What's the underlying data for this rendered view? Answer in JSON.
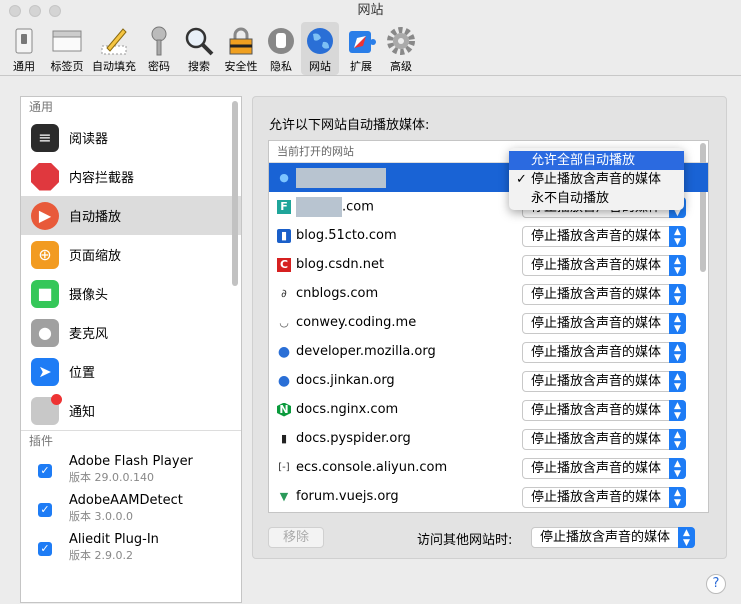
{
  "window": {
    "title": "网站"
  },
  "toolbar": [
    {
      "label": "通用",
      "icon": "general-switch-icon"
    },
    {
      "label": "标签页",
      "icon": "tabs-icon"
    },
    {
      "label": "自动填充",
      "icon": "autofill-pencil-icon"
    },
    {
      "label": "密码",
      "icon": "key-icon"
    },
    {
      "label": "搜索",
      "icon": "magnifier-icon"
    },
    {
      "label": "安全性",
      "icon": "lock-icon"
    },
    {
      "label": "隐私",
      "icon": "hand-icon"
    },
    {
      "label": "网站",
      "icon": "globe-icon"
    },
    {
      "label": "扩展",
      "icon": "puzzle-icon"
    },
    {
      "label": "高级",
      "icon": "gear-icon"
    }
  ],
  "sidebar": {
    "general_header": "通用",
    "items": [
      {
        "label": "阅读器",
        "icon": "reader-icon",
        "color": "#2b2b2b"
      },
      {
        "label": "内容拦截器",
        "icon": "stop-sign-icon",
        "color": "#e0383e"
      },
      {
        "label": "自动播放",
        "icon": "play-icon",
        "color": "#e85a3a"
      },
      {
        "label": "页面缩放",
        "icon": "zoom-icon",
        "color": "#f29b21"
      },
      {
        "label": "摄像头",
        "icon": "camera-icon",
        "color": "#35c759"
      },
      {
        "label": "麦克风",
        "icon": "microphone-icon",
        "color": "#a0a0a0"
      },
      {
        "label": "位置",
        "icon": "location-arrow-icon",
        "color": "#1e7cf5"
      },
      {
        "label": "通知",
        "icon": "notification-icon",
        "color": "#c8c8c8"
      }
    ],
    "plugins_header": "插件",
    "plugins": [
      {
        "name": "Adobe Flash Player",
        "version": "版本 29.0.0.140"
      },
      {
        "name": "AdobeAAMDetect",
        "version": "版本 3.0.0.0"
      },
      {
        "name": "Aliedit Plug-In",
        "version": "版本 2.9.0.2"
      }
    ]
  },
  "main": {
    "title": "允许以下网站自动播放媒体:",
    "table_header": "当前打开的网站",
    "rows": [
      {
        "site": "",
        "setting": "停止播放含声音的媒体"
      },
      {
        "site": ".com",
        "setting": "停止播放含声音的媒体"
      },
      {
        "site": "blog.51cto.com",
        "setting": "停止播放含声音的媒体"
      },
      {
        "site": "blog.csdn.net",
        "setting": "停止播放含声音的媒体"
      },
      {
        "site": "cnblogs.com",
        "setting": "停止播放含声音的媒体"
      },
      {
        "site": "conwey.coding.me",
        "setting": "停止播放含声音的媒体"
      },
      {
        "site": "developer.mozilla.org",
        "setting": "停止播放含声音的媒体"
      },
      {
        "site": "docs.jinkan.org",
        "setting": "停止播放含声音的媒体"
      },
      {
        "site": "docs.nginx.com",
        "setting": "停止播放含声音的媒体"
      },
      {
        "site": "docs.pyspider.org",
        "setting": "停止播放含声音的媒体"
      },
      {
        "site": "ecs.console.aliyun.com",
        "setting": "停止播放含声音的媒体"
      },
      {
        "site": "forum.vuejs.org",
        "setting": "停止播放含声音的媒体"
      }
    ],
    "dropdown_menu": [
      "允许全部自动播放",
      "停止播放含声音的媒体",
      "永不自动播放"
    ],
    "remove_label": "移除",
    "other_label": "访问其他网站时:",
    "other_value": "停止播放含声音的媒体"
  },
  "help": "?"
}
